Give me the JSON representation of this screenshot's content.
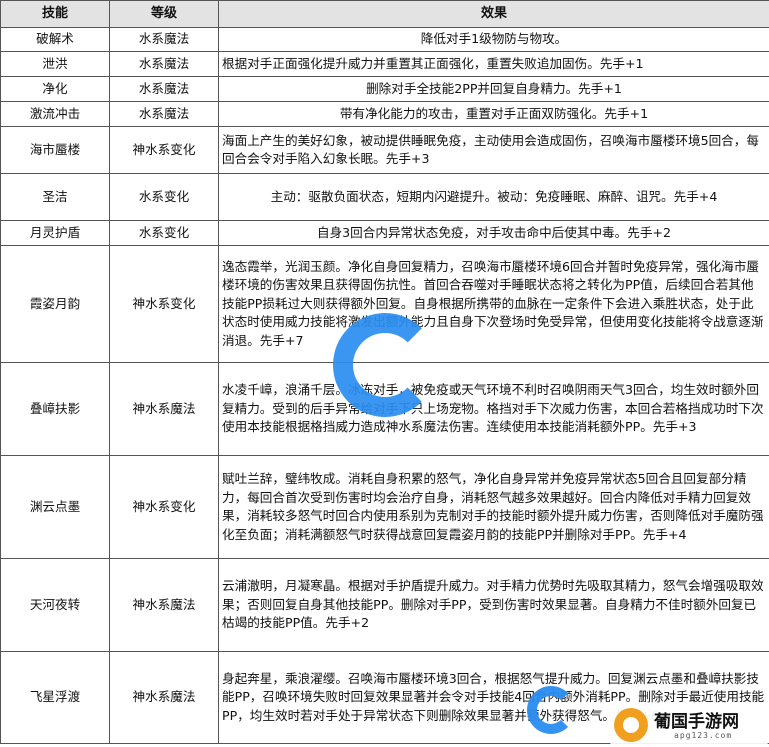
{
  "headers": {
    "skill": "技能",
    "grade": "等级",
    "effect": "效果"
  },
  "rows": [
    {
      "name": "破解术",
      "grade": "水系魔法",
      "effect": "降低对手1级物防与物攻。"
    },
    {
      "name": "泄洪",
      "grade": "水系魔法",
      "effect": "根据对手正面强化提升威力并重置其正面强化，重置失败追加固伤。先手+1"
    },
    {
      "name": "净化",
      "grade": "水系魔法",
      "effect": "删除对手全技能2PP并回复自身精力。先手+1"
    },
    {
      "name": "激流冲击",
      "grade": "水系魔法",
      "effect": "带有净化能力的攻击，重置对手正面双防强化。先手+1"
    },
    {
      "name": "海市蜃楼",
      "grade": "神水系变化",
      "effect": "海面上产生的美好幻象，被动提供睡眠免疫，主动使用会造成固伤，召唤海市蜃楼环境5回合，每回合会令对手陷入幻象长眠。先手+3"
    },
    {
      "name": "圣洁",
      "grade": "水系变化",
      "effect": "主动：驱散负面状态，短期内闪避提升。被动：免疫睡眠、麻醉、诅咒。先手+4"
    },
    {
      "name": "月灵护盾",
      "grade": "水系变化",
      "effect": "自身3回合内异常状态免疫，对手攻击命中后使其中毒。先手+2"
    },
    {
      "name": "霞姿月韵",
      "grade": "神水系变化",
      "effect": "逸态霞举，光润玉颜。净化自身回复精力，召唤海市蜃楼环境6回合并暂时免疫异常，强化海市蜃楼环境的伤害效果且获得固伤抗性。首回合吞噬对手睡眠状态将之转化为PP值，后续回合若其他技能PP损耗过大则获得额外回复。自身根据所携带的血脉在一定条件下会进入乘胜状态，处于此状态时使用威力技能将激发出额外能力且自身下次登场时免受异常，但使用变化技能将令战意逐渐消退。先手+7"
    },
    {
      "name": "叠嶂扶影",
      "grade": "神水系魔法",
      "effect": "水凌千嶂，浪涌千层。冰冻对手，被免疫或天气环境不利时召唤阴雨天气3回合，均生效时额外回复精力。受到的后手异常给对手下只上场宠物。格挡对手下次威力伤害，本回合若格挡成功时下次使用本技能根据格挡威力造成神水系魔法伤害。连续使用本技能消耗额外PP。先手+3"
    },
    {
      "name": "渊云点墨",
      "grade": "神水系变化",
      "effect": "赋吐兰辞，璧纬牧成。消耗自身积累的怒气，净化自身异常并免疫异常状态5回合且回复部分精力，每回合首次受到伤害时均会治疗自身，消耗怒气越多效果越好。回合内降低对手精力回复效果，消耗较多怒气时回合内使用系别为克制对手的技能时额外提升威力伤害，否则降低对手魔防强化至负面；消耗满额怒气时获得战意回复霞姿月韵的技能PP并删除对手PP。先手+4"
    },
    {
      "name": "天河夜转",
      "grade": "神水系魔法",
      "effect": "云浦澈明，月凝寒晶。根据对手护盾提升威力。对手精力优势时先吸取其精力，怒气会增强吸取效果；否则回复自身其他技能PP。删除对手PP，受到伤害时效果显著。自身精力不佳时额外回复已枯竭的技能PP值。先手+2"
    },
    {
      "name": "飞星浮渡",
      "grade": "神水系魔法",
      "effect": "身起奔星，乘浪濯缨。召唤海市蜃楼环境3回合，根据怒气提升威力。回复渊云点墨和叠嶂扶影技能PP，召唤环境失败时回复效果显著并会令对手技能4回合内额外消耗PP。删除对手最近使用技能PP，均生效时若对手处于异常状态下则删除效果显著并额外获得怒气。先手+6"
    }
  ],
  "watermark": {
    "site_name": "葡国手游网",
    "site_url": "apg123.com",
    "brand_color": "#2a8ef0",
    "logo_color": "#f0a01e"
  },
  "colors": {
    "header_bg": "#e3e3e3",
    "border": "#555555"
  }
}
